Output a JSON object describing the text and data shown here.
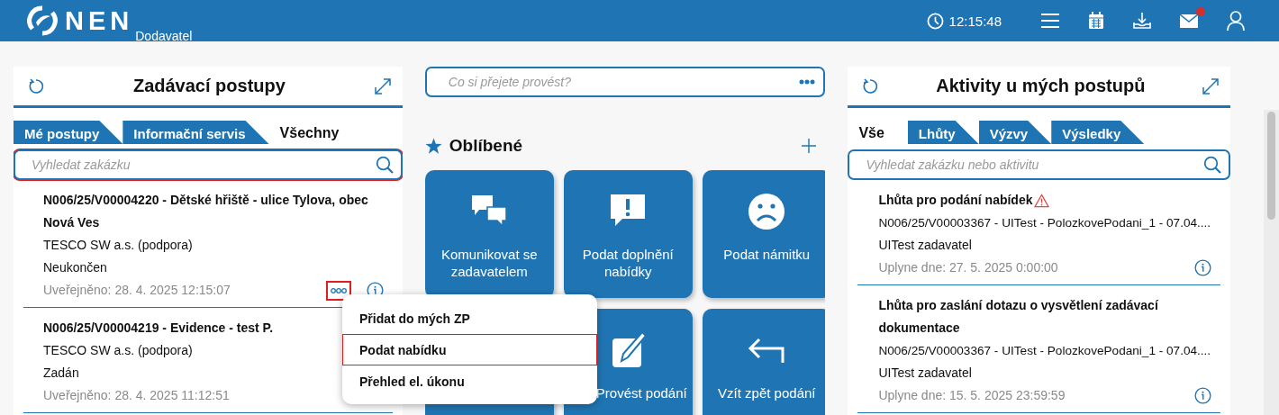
{
  "header": {
    "logo_text": "NEN",
    "subtitle": "Dodavatel",
    "time": "12:15:48",
    "mail_unread": true
  },
  "left_panel": {
    "title": "Zadávací postupy",
    "tabs": [
      {
        "label": "Mé postupy",
        "selected": false
      },
      {
        "label": "Informační servis",
        "selected": false
      },
      {
        "label": "Všechny",
        "selected": true
      }
    ],
    "search": {
      "placeholder": "Vyhledat zakázku",
      "focused": true
    },
    "items": [
      {
        "title": "N006/25/V00004220 - Dětské hřiště - ulice Tylova, obec Nová Ves",
        "company": "TESCO SW a.s. (podpora)",
        "status": "Neukončen",
        "published": "Uveřejněno: 28. 4. 2025 12:15:07",
        "actions": true,
        "more_focused": true
      },
      {
        "title": "N006/25/V00004219 - Evidence - test P.",
        "company": "TESCO SW a.s. (podpora)",
        "status": "Zadán",
        "published": "Uveřejněno: 28. 4. 2025 11:12:51",
        "actions": false
      }
    ]
  },
  "center": {
    "command": {
      "placeholder": "Co si přejete provést?"
    },
    "favorites": {
      "title": "Oblíbené",
      "tiles": [
        {
          "kind": "chat",
          "label": "Komunikovat se zadavatelem"
        },
        {
          "kind": "alert",
          "label": "Podat doplnění nabídky"
        },
        {
          "kind": "complaint",
          "label": "Podat námitku"
        },
        {
          "kind": "hidden"
        },
        {
          "kind": "edit",
          "label": "Provést podání"
        },
        {
          "kind": "withdraw",
          "label": "Vzít zpět podání"
        }
      ]
    }
  },
  "context_menu": {
    "items": [
      {
        "label": "Přidat do mých ZP",
        "focused": false
      },
      {
        "label": "Podat nabídku",
        "focused": true
      },
      {
        "label": "Přehled el. úkonu",
        "focused": false
      }
    ]
  },
  "right_panel": {
    "title": "Aktivity u mých postupů",
    "tabs": [
      {
        "label": "Vše",
        "selected": true
      },
      {
        "label": "Lhůty",
        "selected": false
      },
      {
        "label": "Výzvy",
        "selected": false
      },
      {
        "label": "Výsledky",
        "selected": false
      }
    ],
    "search": {
      "placeholder": "Vyhledat zakázku nebo aktivitu",
      "focused": false
    },
    "items": [
      {
        "title": "Lhůta pro podání nabídek",
        "warning": true,
        "procedure": "N006/25/V00003367 - UITest - PolozkovePodani_1 - 07.04....",
        "authority": "UITest zadavatel",
        "deadline": "Uplyne dne: 27. 5. 2025 0:00:00"
      },
      {
        "title": "Lhůta pro zaslání dotazu o vysvětlení zadávací dokumentace",
        "warning": false,
        "procedure": "N006/25/V00003367 - UITest - PolozkovePodani_1 - 07.04....",
        "authority": "UITest zadavatel",
        "deadline": "Uplyne dne: 15. 5. 2025 23:59:59"
      }
    ]
  }
}
